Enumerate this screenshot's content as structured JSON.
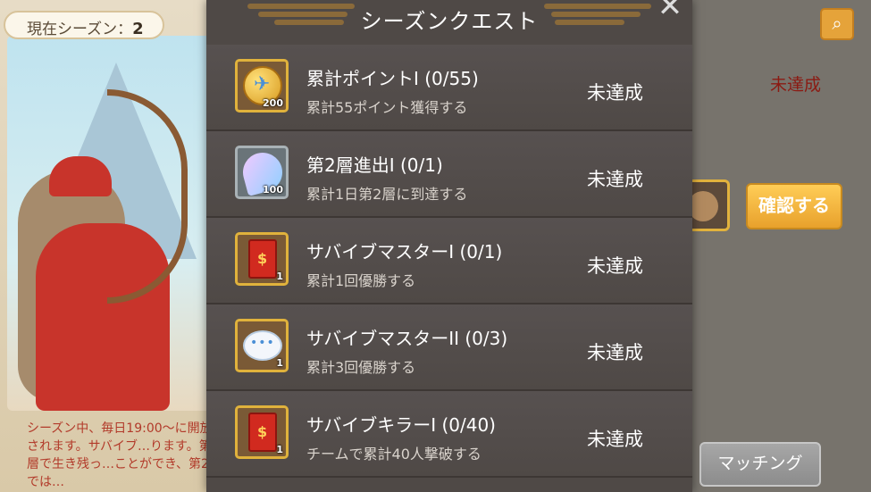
{
  "background": {
    "season_label": "現在シーズン：",
    "season_number": "2",
    "description": "シーズン中、毎日19:00〜に開放されます。サバイブ…ります。第1層で生き残っ…ことができ、第2層では…",
    "right_status": "未達成",
    "confirm_button": "確認する",
    "matching_button": "マッチング",
    "search_icon": "search-icon"
  },
  "modal": {
    "title": "シーズンクエスト",
    "close_icon": "close-icon",
    "quests": [
      {
        "title": "累計ポイントI (0/55)",
        "description": "累計55ポイント獲得する",
        "status": "未達成",
        "reward_icon": "coin-icon",
        "reward_qty": "200"
      },
      {
        "title": "第2層進出I (0/1)",
        "description": "累計1日第2層に到達する",
        "status": "未達成",
        "reward_icon": "gem-icon",
        "reward_qty": "100"
      },
      {
        "title": "サバイブマスターI (0/1)",
        "description": "累計1回優勝する",
        "status": "未達成",
        "reward_icon": "red-envelope-icon",
        "reward_qty": "1"
      },
      {
        "title": "サバイブマスターII (0/3)",
        "description": "累計3回優勝する",
        "status": "未達成",
        "reward_icon": "chat-bubble-icon",
        "reward_qty": "1"
      },
      {
        "title": "サバイブキラーI (0/40)",
        "description": "チームで累計40人撃破する",
        "status": "未達成",
        "reward_icon": "red-envelope-icon",
        "reward_qty": "1"
      }
    ]
  }
}
